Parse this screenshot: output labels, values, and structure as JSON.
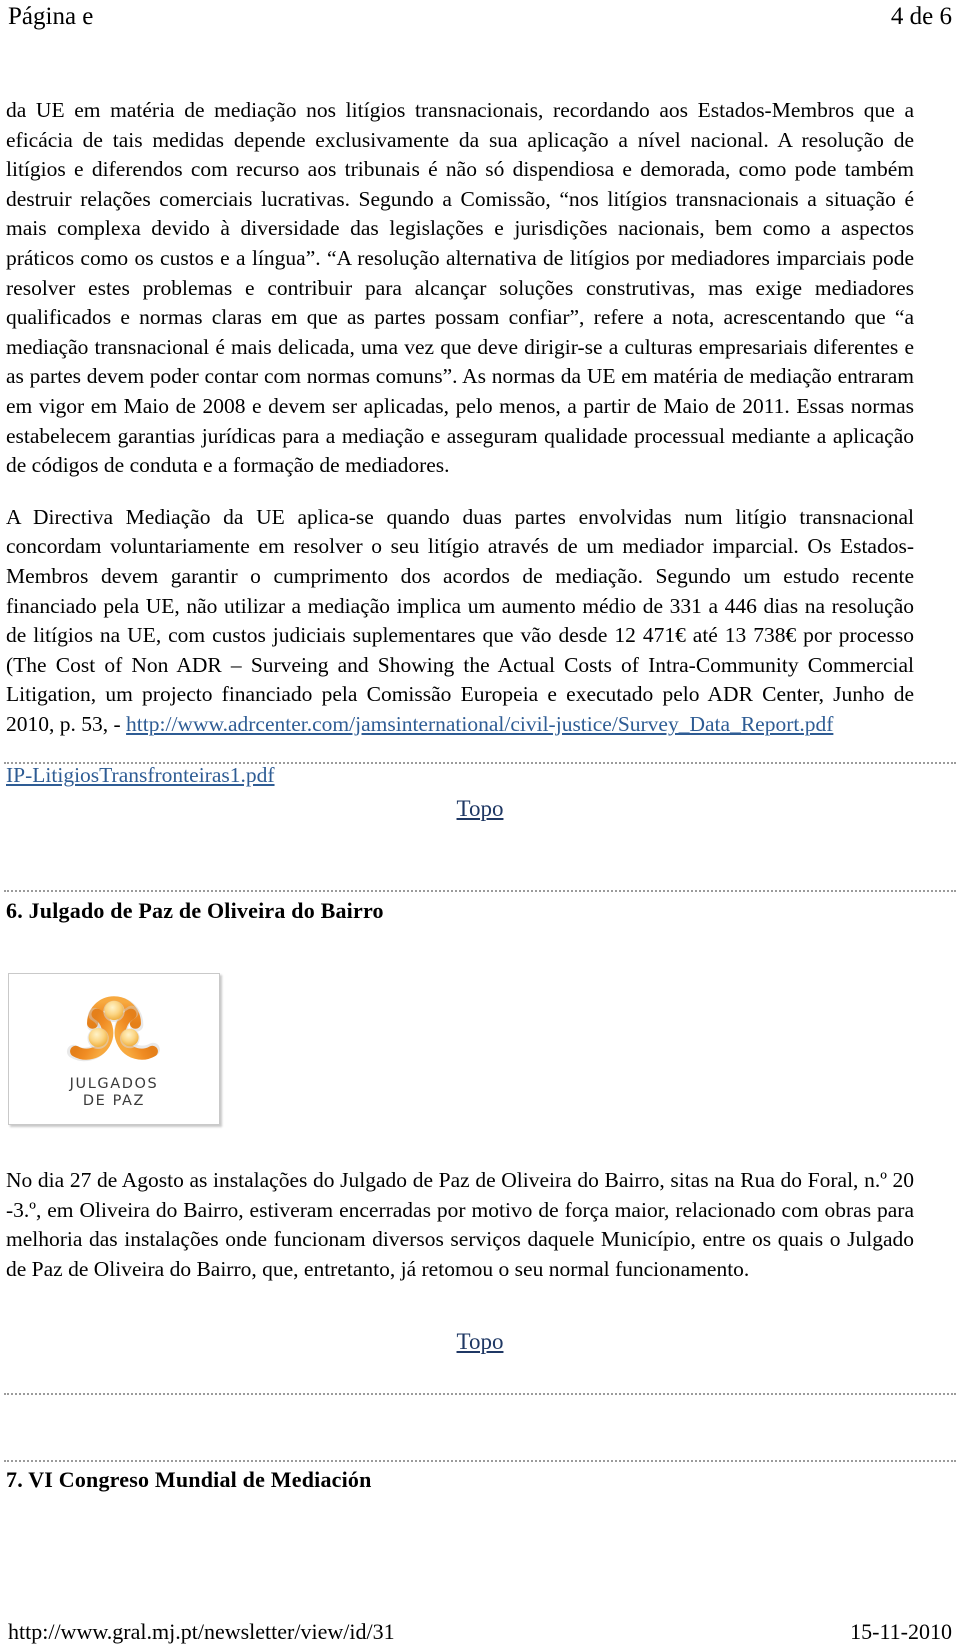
{
  "header": {
    "left": "Página e",
    "right": "4 de 6"
  },
  "body": {
    "paragraph_1": "da UE em matéria de mediação nos litígios transnacionais, recordando aos Estados-Membros que a eficácia de tais medidas depende exclusivamente da sua aplicação a nível nacional. A resolução de litígios e diferendos com recurso aos tribunais é não só dispendiosa e demorada, como pode também destruir relações comerciais lucrativas. Segundo a Comissão, “nos litígios transnacionais a situação é mais complexa devido à diversidade das legislações e jurisdições nacionais, bem como a aspectos práticos como os custos e a língua”. “A resolução alternativa de litígios por mediadores imparciais pode resolver estes problemas e contribuir para alcançar soluções construtivas, mas exige mediadores qualificados e normas claras em que as partes possam confiar”, refere a nota, acrescentando que “a mediação transnacional é mais delicada, uma vez que deve dirigir-se a culturas empresariais diferentes e as partes devem poder contar com normas comuns”. As normas da UE em matéria de mediação entraram em vigor em Maio de 2008 e devem ser aplicadas, pelo menos, a partir de Maio de 2011. Essas normas estabelecem garantias jurídicas para a mediação e asseguram qualidade processual mediante a aplicação de códigos de conduta e a formação de mediadores.",
    "paragraph_2_before_link": "A Directiva Mediação da UE aplica-se quando duas partes envolvidas num litígio transnacional concordam voluntariamente em resolver o seu litígio através de um mediador imparcial. Os Estados-Membros devem garantir o cumprimento dos acordos de mediação. Segundo um estudo recente financiado pela UE, não utilizar a mediação implica um aumento médio de 331 a 446 dias na resolução de litígios na UE, com custos judiciais suplementares que vão desde 12 471€ até 13 738€ por processo (The Cost of Non ADR – Surveing and Showing the Actual Costs of Intra-Community Commercial Litigation, um projecto financiado pela Comissão Europeia e executado pelo ADR Center, Junho de 2010, p. 53, -  ",
    "link_adrcenter": "http://www.adrcenter.com/jamsinternational/civil-justice/Survey_Data_Report.pdf",
    "link_ip_pdf": "IP-LitigiosTransfronteiras1.pdf",
    "topo_1": "Topo",
    "topo_2": "Topo",
    "section_6_heading": "6. Julgado de Paz de Oliveira do Bairro",
    "section_6_paragraph": "No dia 27 de Agosto as instalações do Julgado de Paz de Oliveira do Bairro, sitas na Rua do Foral, n.º 20 -3.º, em Oliveira do Bairro, estiveram encerradas por motivo de força maior, relacionado com obras para melhoria das instalações onde funcionam diversos serviços daquele Município, entre os quais o Julgado de Paz de Oliveira do Bairro, que, entretanto, já retomou o seu normal funcionamento.",
    "section_7_heading": "7. VI Congreso Mundial de Mediación"
  },
  "logo": {
    "caption_line_1": "JULGADOS",
    "caption_line_2": "DE PAZ",
    "arc_color": "#F29230",
    "sphere_color": "#F8CE6E"
  },
  "footer": {
    "url": "http://www.gral.mj.pt/newsletter/view/id/31",
    "date": "15-11-2010"
  }
}
